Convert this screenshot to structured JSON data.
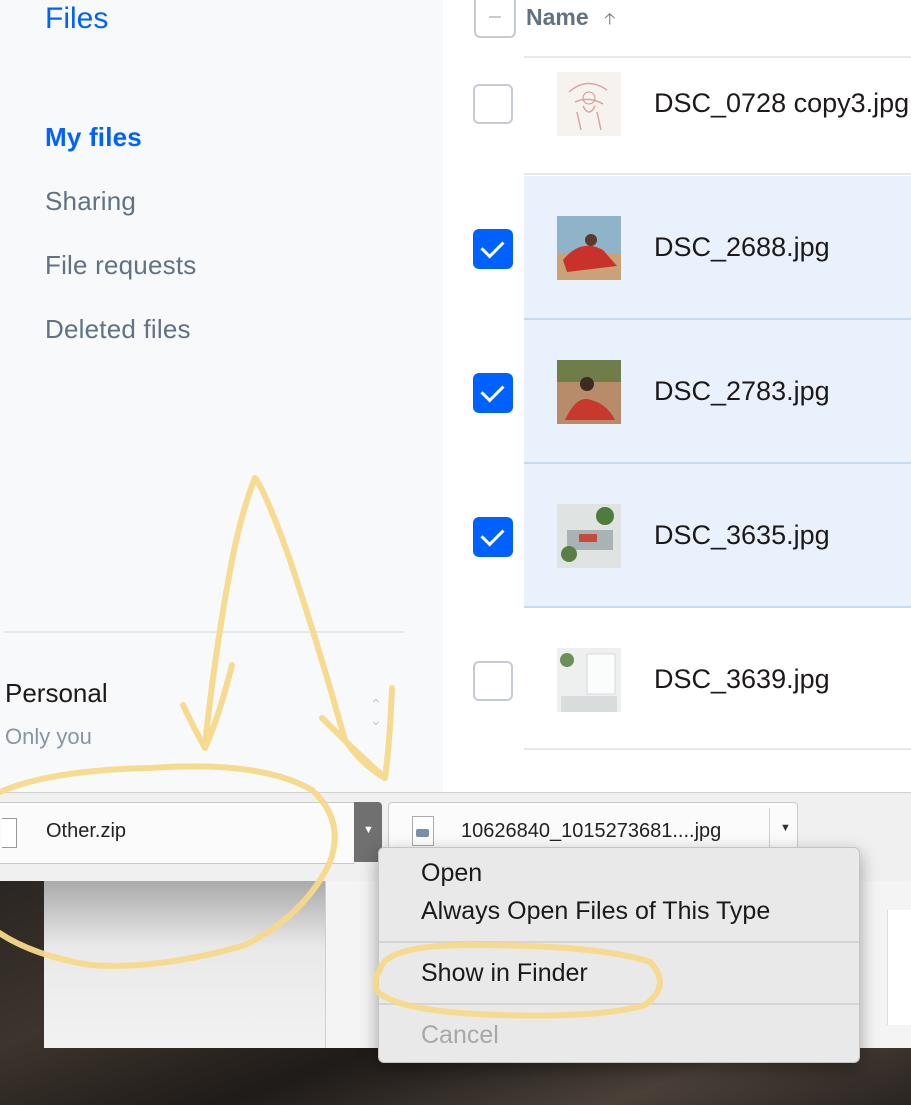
{
  "sidebar": {
    "title": "Files",
    "nav": [
      "My files",
      "Sharing",
      "File requests",
      "Deleted files"
    ],
    "account": {
      "name": "Personal",
      "subtitle": "Only you"
    }
  },
  "file_list": {
    "header": {
      "name_label": "Name",
      "sort_icon": "arrow-up-icon"
    },
    "rows": [
      {
        "name": "DSC_0728 copy3.jpg",
        "checked": false
      },
      {
        "name": "DSC_2688.jpg",
        "checked": true
      },
      {
        "name": "DSC_2783.jpg",
        "checked": true
      },
      {
        "name": "DSC_3635.jpg",
        "checked": true
      },
      {
        "name": "DSC_3639.jpg",
        "checked": false
      }
    ]
  },
  "downloads": {
    "items": [
      {
        "name": "Other.zip",
        "icon": "zip-file-icon"
      },
      {
        "name": "10626840_1015273681....jpg",
        "icon": "image-file-icon"
      }
    ]
  },
  "context_menu": {
    "items": [
      "Open",
      "Always Open Files of This Type",
      "Show in Finder",
      "Cancel"
    ],
    "disabled": [
      "Cancel"
    ]
  },
  "colors": {
    "accent": "#0061fe",
    "selected_row": "#e8f1fc",
    "annotation": "#f6d98a"
  }
}
